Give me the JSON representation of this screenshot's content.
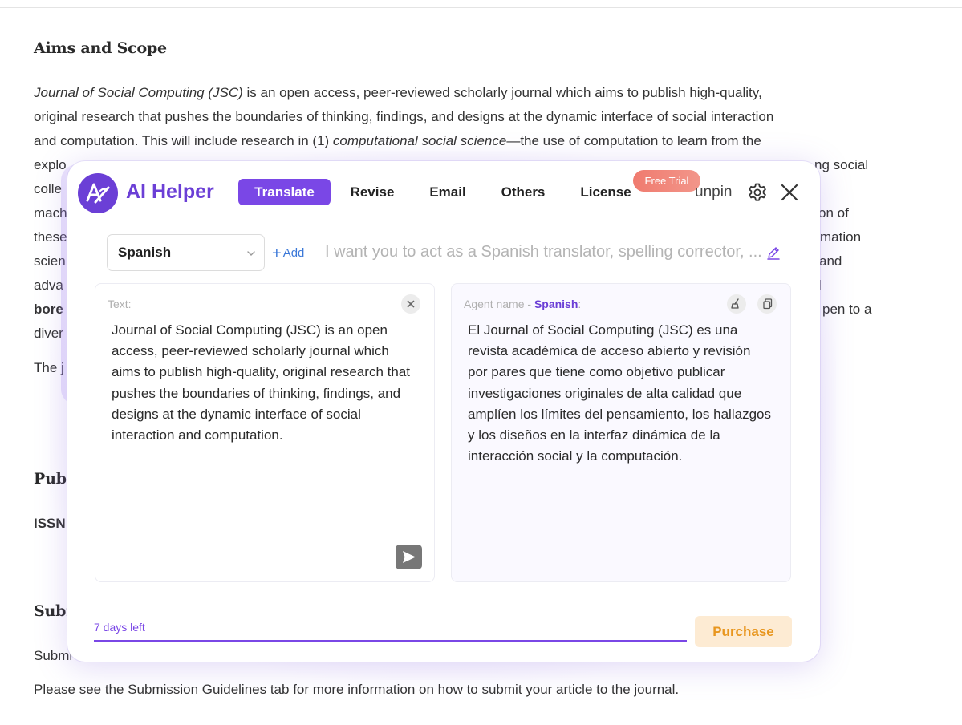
{
  "article": {
    "aims_heading": "Aims and Scope",
    "p1_line1_italic": "Journal of Social Computing (JSC)",
    "p1_line1_rest": " is an open access, peer-reviewed scholarly journal which aims to publish high-quality,",
    "p1_line2": "original research that pushes the boundaries of thinking, findings, and designs at the dynamic interface of social interaction",
    "p1_line3_start": "and computation. This will include research in   (1)  ",
    "p1_line3_italic": "computational social science",
    "p1_line3_end": "—the use of computation to learn from the",
    "line4_left": "explo",
    "line4_right": "ng social",
    "line5_left": "colle",
    "line6_left": "mach",
    "line6_right": "on of",
    "line7_left": "these",
    "line7_right": "mation",
    "line8_left": "scien",
    "line8_right": "and",
    "line9_left": "adva",
    "line9_right": "l",
    "line10_left": "bore",
    "line10_right": "pen to a",
    "line11_left": "diver",
    "line12_left": "The j",
    "pub_heading_fragment": "Publ",
    "issn_fragment": "ISSN",
    "sub_heading_fragment": "Subr",
    "submit_fragment": "Submi",
    "submission_note": "Please see the Submission Guidelines tab for more information on how to submit your article to the journal."
  },
  "helper": {
    "brand": "AI Helper",
    "tabs": [
      {
        "label": "Translate",
        "active": true
      },
      {
        "label": "Revise",
        "active": false
      },
      {
        "label": "Email",
        "active": false
      },
      {
        "label": "Others",
        "active": false
      },
      {
        "label": "License",
        "active": false
      }
    ],
    "trial_badge": "Free Trial",
    "unpin_label": "unpin",
    "language": "Spanish",
    "add_label": "Add",
    "prompt_text": "I want you to act as a Spanish translator, spelling corrector, ...",
    "source": {
      "label": "Text:",
      "text": "Journal of Social Computing (JSC) is an open access, peer-reviewed scholarly journal which aims to publish high-quality, original research that pushes the boundaries of thinking, findings, and designs at the dynamic interface of social interaction and computation."
    },
    "result": {
      "label_prefix": "Agent name - ",
      "agent_name": "Spanish",
      "label_suffix": ":",
      "text": "El Journal of Social Computing (JSC) es una revista académica de acceso abierto y revisión por pares que tiene como objetivo publicar investigaciones originales de alta calidad que amplíen los límites del pensamiento, los hallazgos y los diseños en la interfaz dinámica de la interacción social y la computación."
    },
    "days_left": "7 days left",
    "purchase_label": "Purchase",
    "accent": "#7a47e6",
    "icons": [
      "logo-icon",
      "gear-icon",
      "close-icon",
      "chevron-down-icon",
      "plus-icon",
      "edit-icon",
      "clear-icon",
      "send-icon",
      "broom-icon",
      "copy-icon"
    ]
  }
}
